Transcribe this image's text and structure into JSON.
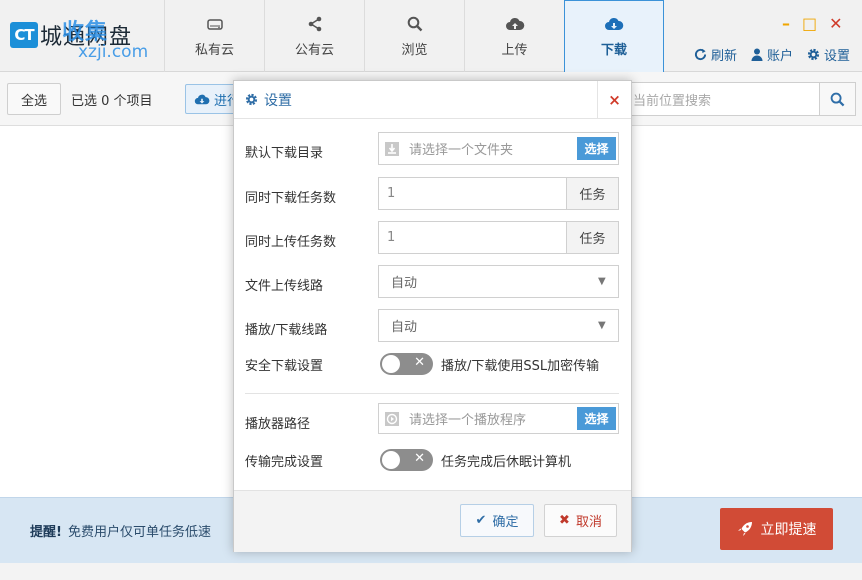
{
  "app": {
    "logo_badge": "CT",
    "logo_text": "城通网盘",
    "watermark_top": "收集",
    "watermark_bottom": "xzji.com"
  },
  "tabs": [
    {
      "label": "私有云",
      "icon": "drive-icon"
    },
    {
      "label": "公有云",
      "icon": "share-icon"
    },
    {
      "label": "浏览",
      "icon": "search-icon"
    },
    {
      "label": "上传",
      "icon": "cloud-upload-icon"
    },
    {
      "label": "下载",
      "icon": "cloud-download-icon",
      "active": true
    }
  ],
  "window_controls": {
    "minimize": "–",
    "maximize": "□",
    "close": "✕"
  },
  "toolbar": {
    "refresh": "刷新",
    "account": "账户",
    "settings": "设置"
  },
  "subbar": {
    "select_all": "全选",
    "selected_text": "已选 0 个项目",
    "progress_label": "进行",
    "search_placeholder": "当前位置搜索"
  },
  "footer": {
    "notice_title": "提醒!",
    "notice_text": "免费用户仅可单任务低速",
    "boost_label": "立即提速"
  },
  "modal": {
    "title": "设置",
    "close": "×",
    "rows": {
      "download_dir": {
        "label": "默认下载目录",
        "placeholder": "请选择一个文件夹",
        "button": "选择"
      },
      "concurrent_download": {
        "label": "同时下载任务数",
        "value": "1",
        "unit": "任务"
      },
      "concurrent_upload": {
        "label": "同时上传任务数",
        "value": "1",
        "unit": "任务"
      },
      "upload_route": {
        "label": "文件上传线路",
        "value": "自动"
      },
      "play_route": {
        "label": "播放/下载线路",
        "value": "自动"
      },
      "secure_download": {
        "label": "安全下载设置",
        "toggle_text": "播放/下载使用SSL加密传输"
      },
      "player_path": {
        "label": "播放器路径",
        "placeholder": "请选择一个播放程序",
        "button": "选择"
      },
      "transfer_done": {
        "label": "传输完成设置",
        "toggle_text": "任务完成后休眠计算机"
      }
    },
    "ok": "确定",
    "cancel": "取消"
  },
  "colors": {
    "accent": "#3b92d8",
    "danger": "#d14b36",
    "footer_bg": "#d7e6f3"
  }
}
